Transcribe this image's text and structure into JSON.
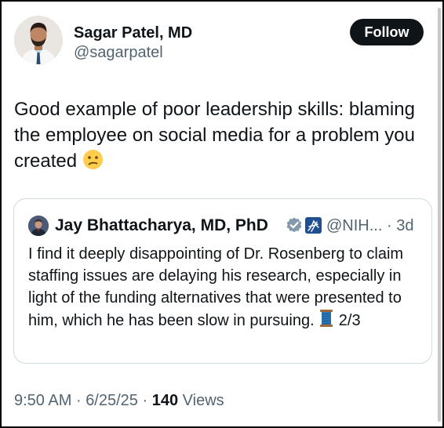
{
  "author": {
    "name": "Sagar Patel, MD",
    "handle": "@sagarpatel",
    "follow_label": "Follow"
  },
  "tweet": {
    "text": "Good example of poor leadership skills: blaming the employee on social media for a problem you created",
    "emoji": "confused-face"
  },
  "quote": {
    "name": "Jay Bhattacharya, MD, PhD",
    "handle": "@NIH...",
    "separator": "·",
    "age": "3d",
    "text": "I find it deeply disappointing of Dr. Rosenberg to claim staffing issues are delaying his research, especially in light of the funding alternatives that were presented to him, which he has been slow in pursuing.",
    "emoji": "thread-spool",
    "thread_position": "2/3",
    "badges": [
      "verified-gray-badge",
      "hhs-affiliation-badge"
    ]
  },
  "meta": {
    "time": "9:50 AM",
    "separator": "·",
    "date": "6/25/25",
    "view_count": "140",
    "views_label": "Views"
  },
  "colors": {
    "text_primary": "#0f1419",
    "text_secondary": "#536471",
    "border": "#cfd9de",
    "follow_bg": "#0f1419",
    "follow_text": "#ffffff",
    "verified_gray": "#829aab",
    "hhs_blue": "#1d4f91"
  }
}
